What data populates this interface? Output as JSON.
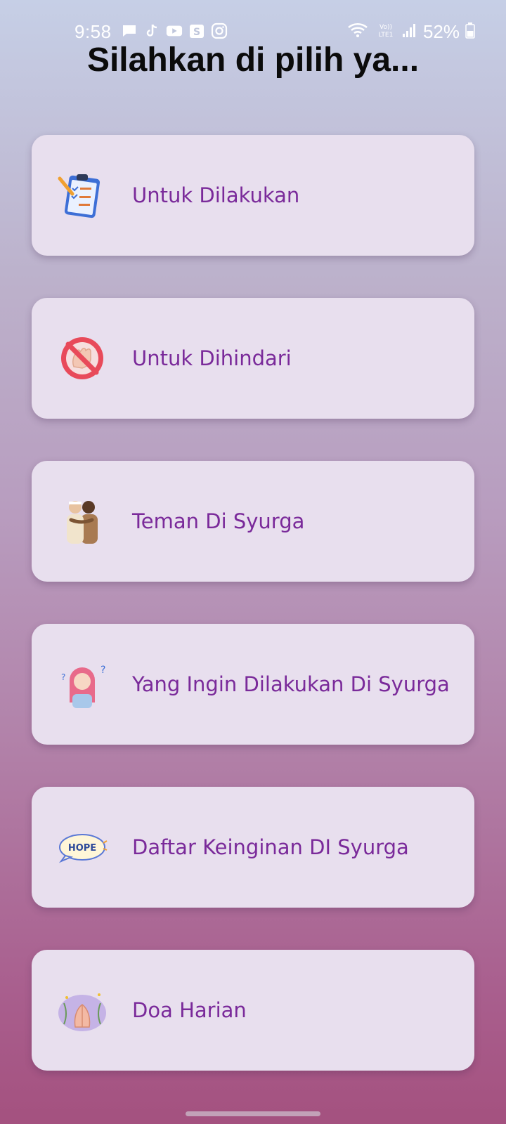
{
  "status_bar": {
    "time": "9:58",
    "battery": "52%",
    "notification_icons": [
      "message-icon",
      "tiktok-icon",
      "youtube-icon",
      "shopee-icon",
      "instagram-icon"
    ]
  },
  "title": "Silahkan di pilih ya...",
  "menu": [
    {
      "label": "Untuk Dilakukan",
      "icon": "clipboard-checklist-icon"
    },
    {
      "label": "Untuk Dihindari",
      "icon": "no-hand-icon"
    },
    {
      "label": "Teman Di Syurga",
      "icon": "friends-hug-icon"
    },
    {
      "label": "Yang Ingin Dilakukan Di Syurga",
      "icon": "thinking-girl-icon"
    },
    {
      "label": "Daftar Keinginan DI Syurga",
      "icon": "hope-bubble-icon",
      "icon_text": "HOPE"
    },
    {
      "label": "Doa Harian",
      "icon": "praying-hands-icon"
    }
  ],
  "colors": {
    "card_bg": "#e8dfee",
    "label_color": "#7a2a9a",
    "title_color": "#0b0b0b"
  }
}
